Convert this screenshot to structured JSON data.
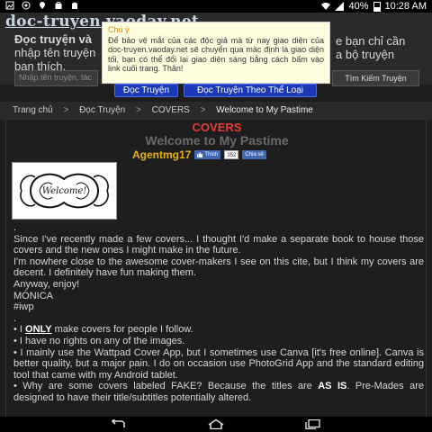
{
  "status_bar": {
    "battery": "40%",
    "time": "10:28 AM",
    "icons": [
      "gallery-icon",
      "chrome-icon",
      "map-icon",
      "shopping-icon",
      "android-icon",
      "wifi-icon",
      "signal-icon",
      "battery-icon"
    ]
  },
  "header": {
    "logo": "doc-truyen.vaoday.net",
    "intro_line1_left": "Đọc truyện và",
    "intro_line1_right": "e bạn chỉ cần",
    "intro_line2_left": "nhập tên truyện",
    "intro_line2_right": "a bộ truyện",
    "intro_line3": "bạn thích.",
    "search_placeholder": "Nhập tên truyện, tác",
    "search_button": "Tìm Kiếm Truyện"
  },
  "notice": {
    "title": "Chú ý",
    "body": "Để bảo vệ mắt của các độc giả mà từ nay giao diện của doc-truyen.vaoday.net sẽ chuyển qua màc định là giao diện tối, bạn có thể đổi lại giao diện sáng bằng cách bấm vào link cuối trang. Thân!"
  },
  "nav": {
    "read_stories": "Đọc Truyện",
    "read_by_genre": "Đọc Truyện Theo Thể Loại"
  },
  "breadcrumb": {
    "home": "Trang chủ",
    "stories": "Đọc Truyện",
    "category": "COVERS",
    "current": "Welcome to My Pastime",
    "separator": ">"
  },
  "story": {
    "category": "COVERS",
    "title": "Welcome to My Pastime",
    "author": "Agentmg17",
    "like_label": "Thích",
    "like_count": "352",
    "share_label": "Chia sẻ",
    "cover_text": "Welcome!"
  },
  "body": {
    "dot": ".",
    "p1": "Since I've recently made a few covers... I thought I'd make a separate book to house those covers and the new ones I might make in the future.",
    "p2": "I'm nowhere close to the awesome cover-makers I see on this cite, but I think my covers are decent. I definitely have fun making them.",
    "p3": "Anyway, enjoy!",
    "p4": "MÓNICA",
    "p5": "#iwp",
    "dot2": ".",
    "b1_pre": "• I ",
    "b1_bold": "ONLY",
    "b1_post": " make covers for people I follow.",
    "b2": "• I have no rights on any of the images.",
    "b3": "• I mainly use the Wattpad Cover App, but I sometimes use Canva [it's free online]. Canva is better quality, but a major pain. I do on occasion use PhotoGrid App and the standard editing tool that came with my Android tablet.",
    "b4_pre": "• Why are some covers labeled FAKE? Because the titles are ",
    "b4_bold": "AS IS",
    "b4_post": ". Pre-Mades are designed to have their title/subtitles potentially altered."
  },
  "colors": {
    "logo": "#c8d3e6",
    "category": "#e53b3b",
    "author": "#e6b213",
    "nav_button": "#1b39b7",
    "notice_bg": "#fffde0"
  }
}
